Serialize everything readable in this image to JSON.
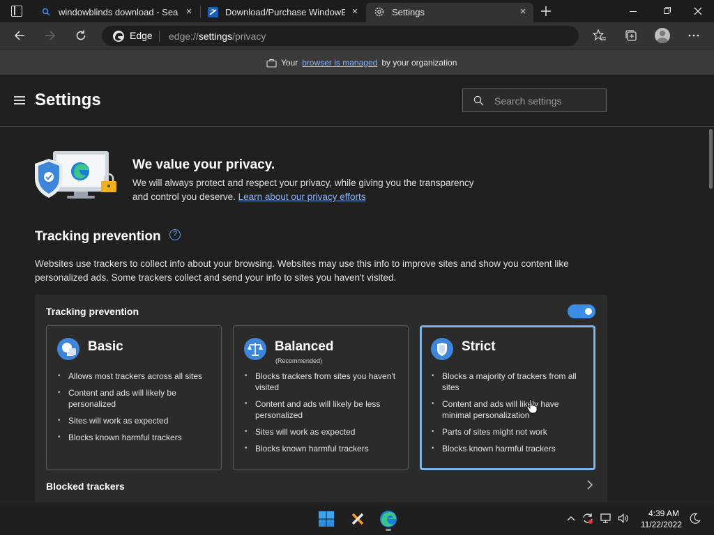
{
  "tabs": [
    {
      "title": "windowblinds download - Search",
      "icon": "search-icon"
    },
    {
      "title": "Download/Purchase WindowBlinds",
      "icon": "stardock-icon"
    },
    {
      "title": "Settings",
      "icon": "gear-icon"
    }
  ],
  "toolbar": {
    "edge_label": "Edge",
    "url_prefix": "edge://",
    "url_host": "settings",
    "url_path": "/privacy"
  },
  "banner": {
    "prefix": "Your",
    "link": "browser is managed",
    "suffix": "by your organization"
  },
  "header": {
    "title": "Settings",
    "search_placeholder": "Search settings"
  },
  "privacy": {
    "title": "We value your privacy.",
    "desc_line1": "We will always protect and respect your privacy, while giving you the transparency",
    "desc_line2": "and control you deserve.",
    "link": "Learn about our privacy efforts"
  },
  "tracking": {
    "heading": "Tracking prevention",
    "help_glyph": "?",
    "desc": "Websites use trackers to collect info about your browsing. Websites may use this info to improve sites and show you content like personalized ads. Some trackers collect and send your info to sites you haven't visited.",
    "panel_label": "Tracking prevention",
    "toggle_on": true,
    "cards": [
      {
        "title": "Basic",
        "subtitle": "",
        "selected": false,
        "bullets": [
          "Allows most trackers across all sites",
          "Content and ads will likely be personalized",
          "Sites will work as expected",
          "Blocks known harmful trackers"
        ]
      },
      {
        "title": "Balanced",
        "subtitle": "(Recommended)",
        "selected": false,
        "bullets": [
          "Blocks trackers from sites you haven't visited",
          "Content and ads will likely be less personalized",
          "Sites will work as expected",
          "Blocks known harmful trackers"
        ]
      },
      {
        "title": "Strict",
        "subtitle": "",
        "selected": true,
        "bullets": [
          "Blocks a majority of trackers from all sites",
          "Content and ads will likely have minimal personalization",
          "Parts of sites might not work",
          "Blocks known harmful trackers"
        ]
      }
    ],
    "blocked_label": "Blocked trackers"
  },
  "taskbar": {
    "time": "4:39 AM",
    "date": "11/22/2022"
  },
  "colors": {
    "accent": "#3a8ee6",
    "link": "#8ab4f8",
    "selected_border": "#7fb3e8"
  }
}
